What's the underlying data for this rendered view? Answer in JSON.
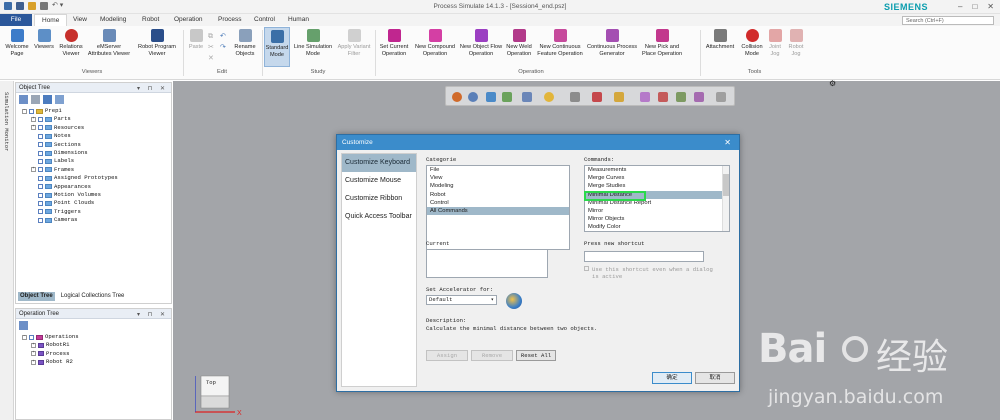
{
  "app": {
    "title": "Process Simulate 14.1.3 - [Session4_end.psz]",
    "brand": "SIEMENS",
    "win_controls": [
      "–",
      "□",
      "✕"
    ]
  },
  "tabs": [
    "File",
    "Home",
    "View",
    "Modeling",
    "Robot",
    "Operation",
    "Process",
    "Control",
    "Human"
  ],
  "active_tab": "Home",
  "search": {
    "placeholder": "Search (Ctrl+F)"
  },
  "ribbon": {
    "viewers": {
      "group_label": "Viewers",
      "buttons": [
        "Welcome Page",
        "Viewers",
        "Relations Viewer",
        "eMServer Attributes Viewer",
        "Robot Program Viewer"
      ]
    },
    "edit": {
      "group_label": "Edit",
      "buttons": [
        "Paste",
        "Rename Objects"
      ]
    },
    "study": {
      "group_label": "Study",
      "buttons": [
        "Standard Mode",
        "Line Simulation Mode",
        "Apply Variant Filter"
      ]
    },
    "operation": {
      "group_label": "Operation",
      "buttons": [
        "Set Current Operation",
        "New Compound Operation",
        "New Object Flow Operation",
        "New Weld Operation",
        "New Continuous Feature Operation",
        "Continuous Process Generator",
        "New Pick and Place Operation"
      ]
    },
    "tools": {
      "group_label": "Tools",
      "buttons": [
        "Attachment",
        "Collision Mode",
        "Joint Jog",
        "Robot Jog"
      ]
    }
  },
  "side_tab": "Simulation Monitor",
  "object_tree": {
    "title": "Object Tree",
    "root": "Prep1",
    "items": [
      "Parts",
      "Resources",
      "Notes",
      "Sections",
      "Dimensions",
      "Labels",
      "Frames",
      "Assigned Prototypes",
      "Appearances",
      "Motion Volumes",
      "Point Clouds",
      "Triggers",
      "Cameras"
    ],
    "bottom_tabs": [
      "Object Tree",
      "Logical Collections Tree"
    ]
  },
  "operation_tree": {
    "title": "Operation Tree",
    "root": "Operations",
    "items": [
      "RobotR1",
      "Process",
      "Robot R2"
    ]
  },
  "dialog": {
    "title": "Customize",
    "close": "✕",
    "nav": [
      "Customize Keyboard",
      "Customize Mouse",
      "Customize Ribbon",
      "Quick Access Toolbar"
    ],
    "categories_label": "Categorie",
    "categories": [
      "File",
      "View",
      "Modeling",
      "Robot",
      "Control",
      "All Commands"
    ],
    "selected_category": "All Commands",
    "commands_label": "Commands:",
    "commands": [
      "Measurements",
      "Merge Curves",
      "Merge Studies",
      "Minimal Distance",
      "Minimal Distance Report",
      "Mirror",
      "Mirror Objects",
      "Modify Color"
    ],
    "selected_command": "Minimal Distance",
    "current_label": "Current",
    "shortcut_label": "Press new shortcut",
    "shortcut_checkbox": "Use this shortcut even when a dialog is active",
    "accelerator_label": "Set Accelerator for:",
    "accelerator_value": "Default",
    "description_label": "Description:",
    "description": "Calculate the minimal distance between two objects.",
    "buttons": {
      "assign": "Assign",
      "remove": "Remove",
      "reset": "Reset All",
      "ok": "确定",
      "cancel": "取消"
    }
  },
  "cube": {
    "face": "Top"
  },
  "watermark": {
    "logo": "Bai",
    "logo_cn": "经验",
    "url": "jingyan.baidu.com"
  },
  "colors": {
    "accent": "#2b579a",
    "dialog_title": "#3b8ccb",
    "selection": "#9fb8c9",
    "highlight": "#2bd94c",
    "viewport": "#a3a5a9"
  }
}
